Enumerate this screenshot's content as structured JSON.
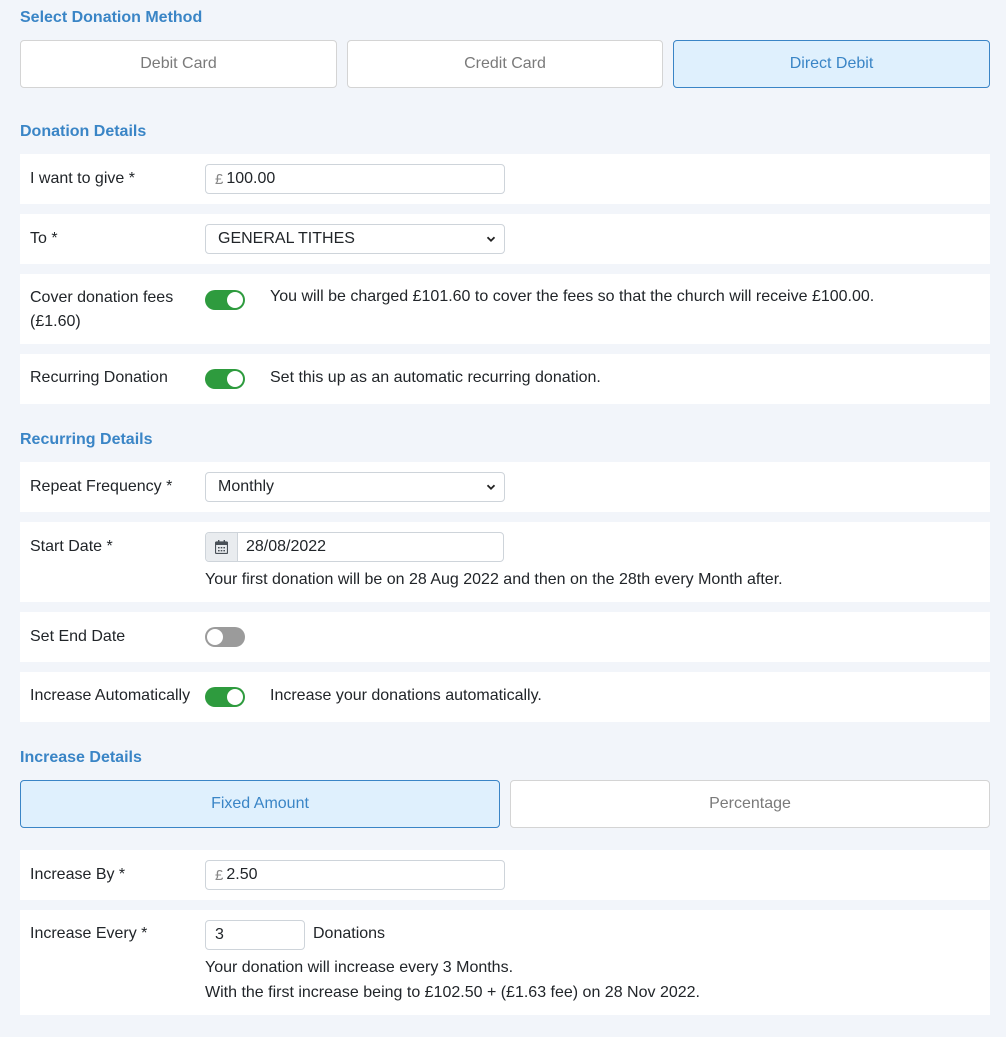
{
  "method_section": {
    "title": "Select Donation Method",
    "options": [
      {
        "label": "Debit Card",
        "selected": false
      },
      {
        "label": "Credit Card",
        "selected": false
      },
      {
        "label": "Direct Debit",
        "selected": true
      }
    ]
  },
  "donation_section": {
    "title": "Donation Details",
    "amount": {
      "label": "I want to give *",
      "currency_symbol": "£",
      "value": "100.00"
    },
    "fund": {
      "label": "To *",
      "selected": "GENERAL TITHES"
    },
    "cover_fees": {
      "label_line1": "Cover donation fees",
      "label_line2": "(£1.60)",
      "on": true,
      "text": "You will be charged £101.60 to cover the fees so that the church will receive £100.00."
    },
    "recurring": {
      "label": "Recurring Donation",
      "on": true,
      "text": "Set this up as an automatic recurring donation."
    }
  },
  "recurring_section": {
    "title": "Recurring Details",
    "frequency": {
      "label": "Repeat Frequency *",
      "selected": "Monthly"
    },
    "start_date": {
      "label": "Start Date *",
      "icon": "calendar-icon",
      "value": "28/08/2022",
      "helper": "Your first donation will be on 28 Aug 2022 and then on the 28th every Month after."
    },
    "end_date": {
      "label": "Set End Date",
      "on": false
    },
    "increase_auto": {
      "label": "Increase Automatically",
      "on": true,
      "text": "Increase your donations automatically."
    }
  },
  "increase_section": {
    "title": "Increase Details",
    "options": [
      {
        "label": "Fixed Amount",
        "selected": true
      },
      {
        "label": "Percentage",
        "selected": false
      }
    ],
    "increase_by": {
      "label": "Increase By *",
      "currency_symbol": "£",
      "value": "2.50"
    },
    "increase_every": {
      "label": "Increase Every *",
      "value": "3",
      "unit": "Donations",
      "helper_line1": "Your donation will increase every 3 Months.",
      "helper_line2": "With the first increase being to £102.50 + (£1.63 fee) on 28 Nov 2022."
    }
  },
  "colors": {
    "accent": "#3a85c6",
    "toggle_on": "#2e9b3e",
    "toggle_off": "#9b9b9b",
    "page_bg": "#f2f5fa",
    "selected_bg": "#dff0fd"
  }
}
